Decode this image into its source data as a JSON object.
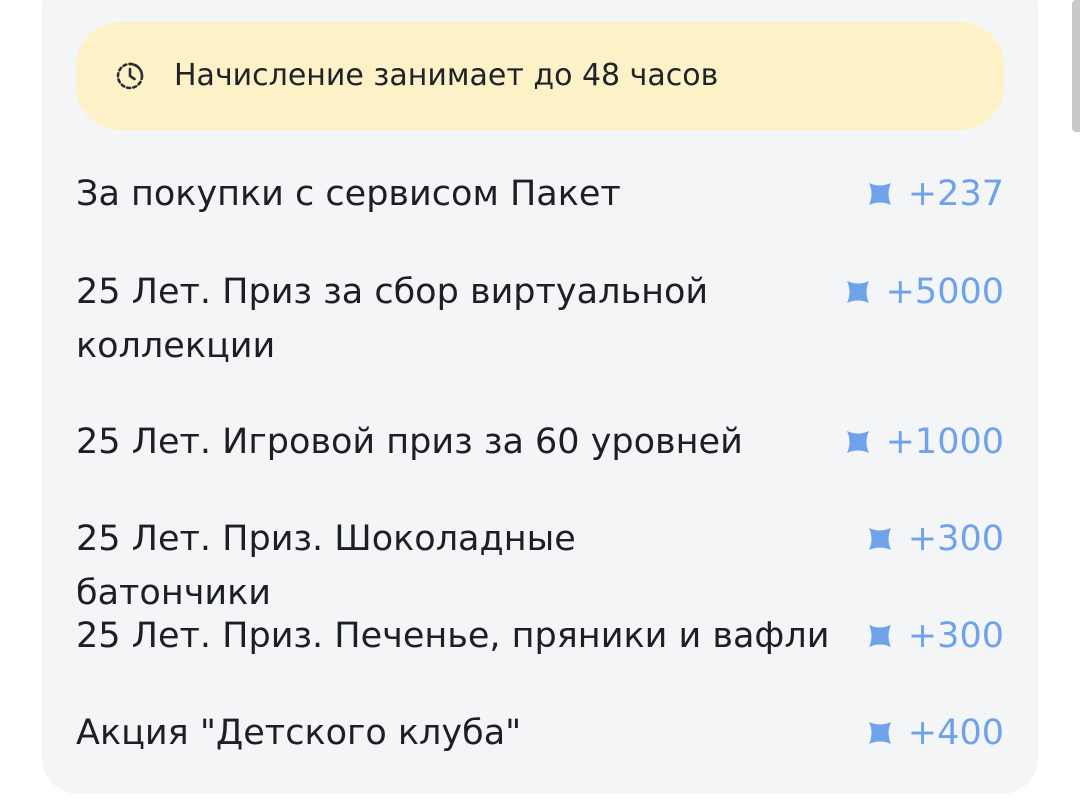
{
  "banner": {
    "icon": "clock-refresh-icon",
    "text": "Начисление занимает до 48 часов",
    "background": "#fdf1c8"
  },
  "accent_color": "#6fa2ea",
  "rows": [
    {
      "label": "За покупки с сервисом Пакет",
      "amount": "+237",
      "icon": "bonus-cross-icon"
    },
    {
      "label": "25 Лет. Приз за сбор виртуальной коллекции",
      "amount": "+5000",
      "icon": "bonus-cross-icon"
    },
    {
      "label": "25 Лет. Игровой приз за 60 уровней",
      "amount": "+1000",
      "icon": "bonus-cross-icon"
    },
    {
      "label": "25 Лет. Приз. Шоколадные батончики",
      "amount": "+300",
      "icon": "bonus-cross-icon"
    },
    {
      "label": "25 Лет. Приз. Печенье, пряники и вафли",
      "amount": "+300",
      "icon": "bonus-cross-icon"
    },
    {
      "label": "Акция \"Детского клуба\"",
      "amount": "+400",
      "icon": "bonus-cross-icon"
    }
  ]
}
